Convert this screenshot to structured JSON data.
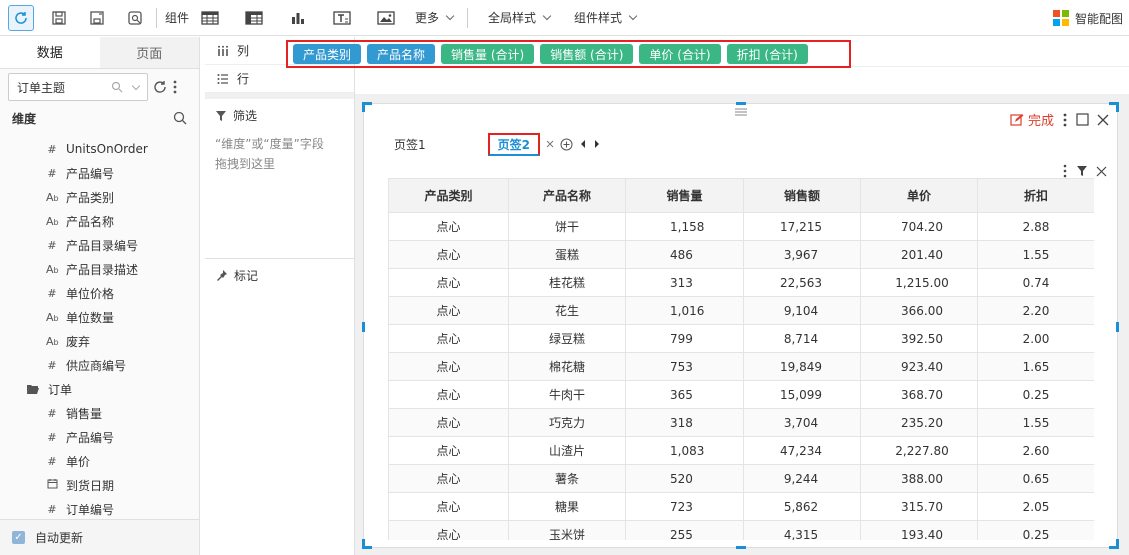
{
  "toolbar": {
    "component_label": "组件",
    "more_label": "更多",
    "global_style_label": "全局样式",
    "component_style_label": "组件样式",
    "smart_chart_label": "智能配图"
  },
  "left_panel": {
    "tabs": [
      "数据",
      "页面"
    ],
    "theme_value": "订单主题",
    "dimension_header": "维度",
    "fields": [
      {
        "type": "#",
        "label": "UnitsOnOrder"
      },
      {
        "type": "#",
        "label": "产品编号"
      },
      {
        "type": "Ab",
        "label": "产品类别"
      },
      {
        "type": "Ab",
        "label": "产品名称"
      },
      {
        "type": "#",
        "label": "产品目录编号"
      },
      {
        "type": "Ab",
        "label": "产品目录描述"
      },
      {
        "type": "#",
        "label": "单位价格"
      },
      {
        "type": "Ab",
        "label": "单位数量"
      },
      {
        "type": "Ab",
        "label": "废弃"
      },
      {
        "type": "#",
        "label": "供应商编号"
      }
    ],
    "folder_label": "订单",
    "order_fields": [
      {
        "type": "#",
        "label": "销售量"
      },
      {
        "type": "#",
        "label": "产品编号"
      },
      {
        "type": "#",
        "label": "单价"
      },
      {
        "type": "date",
        "label": "到货日期"
      },
      {
        "type": "#",
        "label": "订单编号"
      }
    ],
    "auto_update_label": "自动更新"
  },
  "config": {
    "columns_label": "列",
    "rows_label": "行",
    "filter_label": "筛选",
    "filter_hint_1": "“维度”或“度量”字段",
    "filter_hint_2": "拖拽到这里",
    "marks_label": "标记"
  },
  "shelf": {
    "pills": [
      {
        "label": "产品类别",
        "kind": "dim"
      },
      {
        "label": "产品名称",
        "kind": "dim"
      },
      {
        "label": "销售量 (合计)",
        "kind": "mea"
      },
      {
        "label": "销售额 (合计)",
        "kind": "mea"
      },
      {
        "label": "单价 (合计)",
        "kind": "mea"
      },
      {
        "label": "折扣 (合计)",
        "kind": "mea"
      }
    ]
  },
  "component": {
    "done_label": "完成",
    "page_tabs": [
      "页签1",
      "页签2"
    ]
  },
  "table": {
    "headers": [
      "产品类别",
      "产品名称",
      "销售量",
      "销售额",
      "单价",
      "折扣"
    ],
    "rows": [
      [
        "点心",
        "饼干",
        "1,158",
        "17,215",
        "704.20",
        "2.88"
      ],
      [
        "点心",
        "蛋糕",
        "486",
        "3,967",
        "201.40",
        "1.55"
      ],
      [
        "点心",
        "桂花糕",
        "313",
        "22,563",
        "1,215.00",
        "0.74"
      ],
      [
        "点心",
        "花生",
        "1,016",
        "9,104",
        "366.00",
        "2.20"
      ],
      [
        "点心",
        "绿豆糕",
        "799",
        "8,714",
        "392.50",
        "2.00"
      ],
      [
        "点心",
        "棉花糖",
        "753",
        "19,849",
        "923.40",
        "1.65"
      ],
      [
        "点心",
        "牛肉干",
        "365",
        "15,099",
        "368.70",
        "0.25"
      ],
      [
        "点心",
        "巧克力",
        "318",
        "3,704",
        "235.20",
        "1.55"
      ],
      [
        "点心",
        "山渣片",
        "1,083",
        "47,234",
        "2,227.80",
        "2.60"
      ],
      [
        "点心",
        "薯条",
        "520",
        "9,244",
        "388.00",
        "0.65"
      ],
      [
        "点心",
        "糖果",
        "723",
        "5,862",
        "315.70",
        "2.05"
      ],
      [
        "点心",
        "玉米饼",
        "255",
        "4,315",
        "193.40",
        "0.25"
      ]
    ]
  }
}
